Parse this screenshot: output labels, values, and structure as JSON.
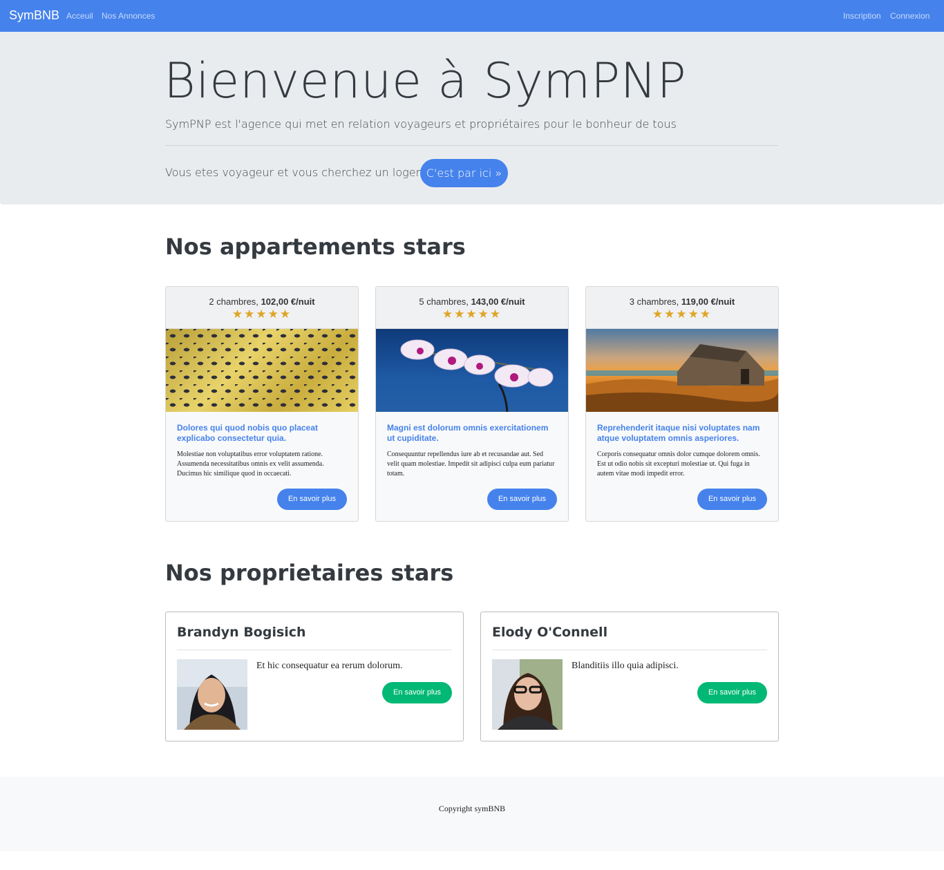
{
  "navbar": {
    "brand": "SymBNB",
    "left_links": [
      "Acceuil",
      "Nos Annonces"
    ],
    "right_links": [
      "Inscription",
      "Connexion"
    ],
    "color": "#4582ec"
  },
  "jumbotron": {
    "title": "Bienvenue à SymPNP",
    "lead": "SymPNP est l'agence qui met en relation voyageurs et propriétaires pour le bonheur de tous",
    "question": "Vous etes voyageur et vous cherchez un logement?",
    "cta_label": "C'est par ici »"
  },
  "ads_section": {
    "title": "Nos appartements stars",
    "items": [
      {
        "rooms": "2 chambres,",
        "price": "102,00 €/nuit",
        "stars": "★★★★★",
        "image": "golden-pattern-image",
        "title": "Dolores qui quod nobis quo placeat explicabo consectetur quia.",
        "text": "Molestiae non voluptatibus error voluptatem ratione. Assumenda necessitatibus omnis ex velit assumenda. Ducimus hic similique quod in occaecati.",
        "button": "En savoir plus"
      },
      {
        "rooms": "5 chambres,",
        "price": "143,00 €/nuit",
        "stars": "★★★★★",
        "image": "orchid-image",
        "title": "Magni est dolorum omnis exercitationem ut cupiditate.",
        "text": "Consequuntur repellendus iure ab et recusandae aut. Sed velit quam molestiae. Impedit sit adipisci culpa eum pariatur totam.",
        "button": "En savoir plus"
      },
      {
        "rooms": "3 chambres,",
        "price": "119,00 €/nuit",
        "stars": "★★★★★",
        "image": "stone-house-image",
        "title": "Reprehenderit itaque nisi voluptates nam atque voluptatem omnis asperiores.",
        "text": "Corporis consequatur omnis dolor cumque dolorem omnis. Est ut odio nobis sit excepturi molestiae ut. Qui fuga in autem vitae modi impedit error.",
        "button": "En savoir plus"
      }
    ]
  },
  "owners_section": {
    "title": "Nos proprietaires stars",
    "items": [
      {
        "name": "Brandyn Bogisich",
        "quote": "Et hic consequatur ea rerum dolorum.",
        "button": "En savoir plus"
      },
      {
        "name": "Elody O'Connell",
        "quote": "Blanditiis illo quia adipisci.",
        "button": "En savoir plus"
      }
    ]
  },
  "footer": {
    "text": "Copyright symBNB"
  },
  "colors": {
    "primary": "#4582ec",
    "success": "#02b875",
    "star": "#e0a325",
    "jumbotron_bg": "#e9ecef"
  }
}
